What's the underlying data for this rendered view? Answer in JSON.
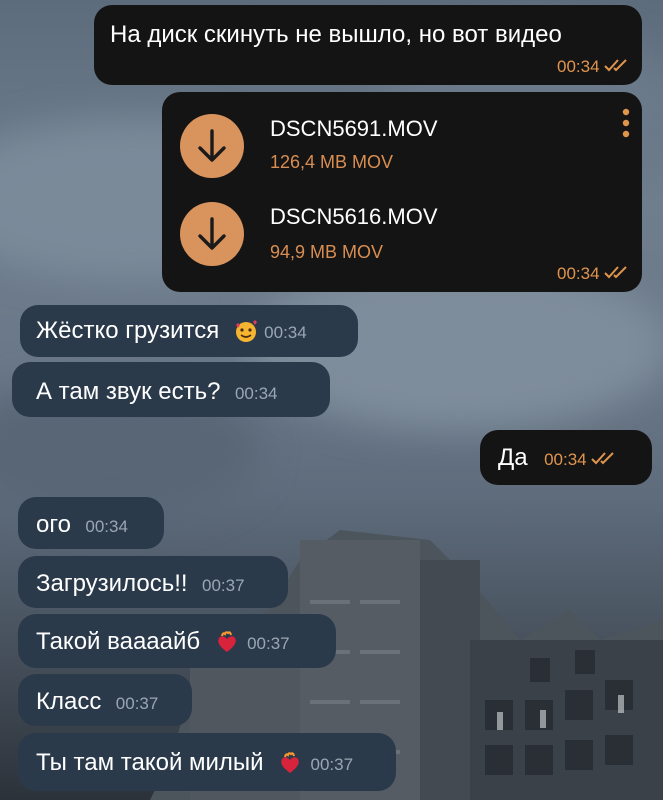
{
  "messages": {
    "m1": {
      "text": "На диск скинуть не вышло, но вот видео",
      "time": "00:34"
    },
    "files": {
      "items": [
        {
          "name": "DSCN5691.MOV",
          "size": "126,4 MB MOV"
        },
        {
          "name": "DSCN5616.MOV",
          "size": "94,9 MB MOV"
        }
      ],
      "time": "00:34"
    },
    "m3": {
      "text": "Жёстко грузится",
      "time": "00:34",
      "emoji": "smiling-face-with-hearts-icon"
    },
    "m4": {
      "text": "А там звук есть?",
      "time": "00:34"
    },
    "m5": {
      "text": "Да",
      "time": "00:34"
    },
    "m6": {
      "text": "ого",
      "time": "00:34"
    },
    "m7": {
      "text": "Загрузилось!!",
      "time": "00:37"
    },
    "m8": {
      "text": "Такой ваааайб",
      "time": "00:37",
      "emoji": "heart-on-fire-icon"
    },
    "m9": {
      "text": "Класс",
      "time": "00:37"
    },
    "m10": {
      "text": "Ты там такой милый",
      "time": "00:37",
      "emoji": "heart-on-fire-icon"
    }
  },
  "colors": {
    "outgoing_bubble": "#141414",
    "incoming_bubble": "#2b3a4b",
    "accent": "#d9935d",
    "outgoing_time": "#e0954d"
  }
}
